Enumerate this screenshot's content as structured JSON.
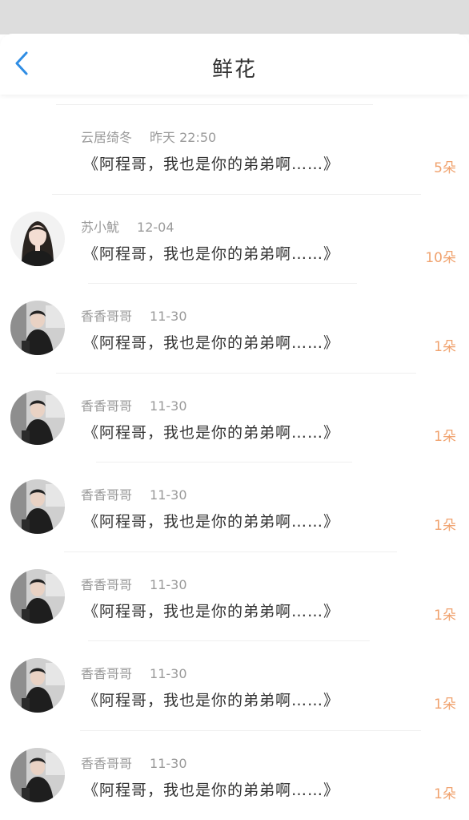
{
  "header": {
    "title": "鲜花",
    "accent_color": "#2f8de4"
  },
  "list": [
    {
      "name": "云居绮冬",
      "time": "昨天 22:50",
      "message": "《阿程哥，我也是你的弟弟啊……》",
      "flowers": "5朵",
      "avatar": "none"
    },
    {
      "name": "苏小魷",
      "time": "12-04",
      "message": "《阿程哥，我也是你的弟弟啊……》",
      "flowers": "10朵",
      "avatar": "girl-avatar"
    },
    {
      "name": "香香哥哥",
      "time": "11-30",
      "message": "《阿程哥，我也是你的弟弟啊……》",
      "flowers": "1朵",
      "avatar": "boy-avatar"
    },
    {
      "name": "香香哥哥",
      "time": "11-30",
      "message": "《阿程哥，我也是你的弟弟啊……》",
      "flowers": "1朵",
      "avatar": "boy-avatar"
    },
    {
      "name": "香香哥哥",
      "time": "11-30",
      "message": "《阿程哥，我也是你的弟弟啊……》",
      "flowers": "1朵",
      "avatar": "boy-avatar"
    },
    {
      "name": "香香哥哥",
      "time": "11-30",
      "message": "《阿程哥，我也是你的弟弟啊……》",
      "flowers": "1朵",
      "avatar": "boy-avatar"
    },
    {
      "name": "香香哥哥",
      "time": "11-30",
      "message": "《阿程哥，我也是你的弟弟啊……》",
      "flowers": "1朵",
      "avatar": "boy-avatar"
    },
    {
      "name": "香香哥哥",
      "time": "11-30",
      "message": "《阿程哥，我也是你的弟弟啊……》",
      "flowers": "1朵",
      "avatar": "boy-avatar"
    }
  ]
}
